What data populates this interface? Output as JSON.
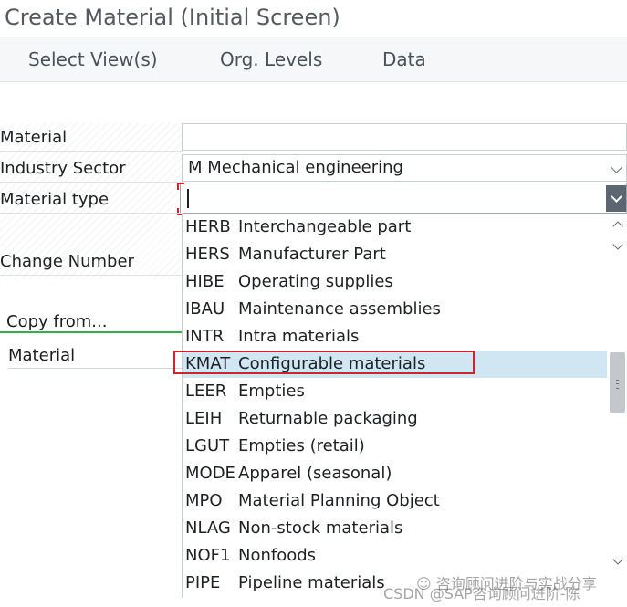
{
  "window": {
    "title": "Create Material (Initial Screen)"
  },
  "toolbar": {
    "select_views": "Select View(s)",
    "org_levels": "Org. Levels",
    "data": "Data"
  },
  "form": {
    "material_label": "Material",
    "material_value": "",
    "industry_sector_label": "Industry Sector",
    "industry_sector_value": "M Mechanical engineering",
    "material_type_label": "Material type",
    "material_type_value": "",
    "change_number_label": "Change Number"
  },
  "copy_from": {
    "title": "Copy from...",
    "material_label": "Material"
  },
  "material_type_list": [
    {
      "code": "HERB",
      "desc": "Interchangeable part"
    },
    {
      "code": "HERS",
      "desc": "Manufacturer Part"
    },
    {
      "code": "HIBE",
      "desc": "Operating supplies"
    },
    {
      "code": "IBAU",
      "desc": "Maintenance assemblies"
    },
    {
      "code": "INTR",
      "desc": "Intra materials"
    },
    {
      "code": "KMAT",
      "desc": "Configurable materials"
    },
    {
      "code": "LEER",
      "desc": "Empties"
    },
    {
      "code": "LEIH",
      "desc": "Returnable packaging"
    },
    {
      "code": "LGUT",
      "desc": "Empties (retail)"
    },
    {
      "code": "MODE",
      "desc": "Apparel (seasonal)"
    },
    {
      "code": "MPO",
      "desc": "Material Planning Object"
    },
    {
      "code": "NLAG",
      "desc": "Non-stock materials"
    },
    {
      "code": "NOF1",
      "desc": "Nonfoods"
    },
    {
      "code": "PIPE",
      "desc": "Pipeline materials"
    }
  ],
  "selected_code": "KMAT",
  "watermark": {
    "line1": "☺ 咨询顾问进阶与实战分享",
    "line2": "CSDN @SAP咨询顾问进阶-陈"
  },
  "colors": {
    "highlight_red": "#d2232a",
    "selection_bg": "#d1e6f3",
    "copy_line_green": "#2cb34a",
    "dropdown_button": "#5c6670"
  },
  "icons": [
    "chevron-down-icon",
    "scroll-up-icon",
    "scroll-down-icon",
    "scroll-grip-icon"
  ]
}
